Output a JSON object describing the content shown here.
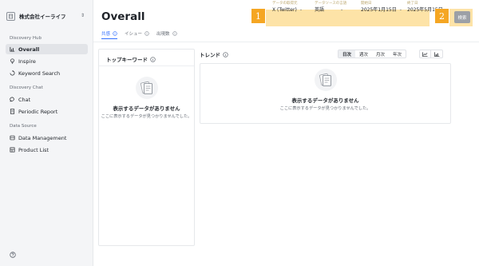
{
  "sidebar": {
    "org_name": "株式会社イーライフ",
    "sections": {
      "hub": "Discovery Hub",
      "chat": "Discovery Chat",
      "source": "Data Source"
    },
    "items": [
      {
        "label": "Overall",
        "icon": "chart-icon",
        "active": true
      },
      {
        "label": "Inspire",
        "icon": "lightbulb-icon"
      },
      {
        "label": "Keyword Search",
        "icon": "search-icon"
      },
      {
        "label": "Chat",
        "icon": "chat-icon"
      },
      {
        "label": "Periodic Report",
        "icon": "document-icon"
      },
      {
        "label": "Data Management",
        "icon": "database-icon"
      },
      {
        "label": "Product List",
        "icon": "list-icon"
      }
    ]
  },
  "page": {
    "title": "Overall"
  },
  "tabs": [
    {
      "label": "共感",
      "active": true
    },
    {
      "label": "イシュー"
    },
    {
      "label": "出現数"
    }
  ],
  "filters": [
    {
      "label": "データの取得元",
      "value": "X (Twitter)"
    },
    {
      "label": "データソースの言語",
      "value": "英語"
    },
    {
      "label": "開始日",
      "value": "2025年1月15日"
    },
    {
      "label": "終了日",
      "value": "2025年5月15日"
    }
  ],
  "badges": [
    "1",
    "2"
  ],
  "search_button": "検索",
  "keywords_panel": {
    "title": "トップキーワード",
    "empty_title": "表示するデータがありません",
    "empty_sub": "ここに表示するデータが見つかりませんでした。"
  },
  "trend_panel": {
    "title": "トレンド",
    "granularity": [
      "日次",
      "週次",
      "月次",
      "年次"
    ],
    "active_granularity": "日次",
    "empty_title": "表示するデータがありません",
    "empty_sub": "ここに表示するデータが見つかりませんでした。"
  },
  "colors": {
    "accent": "#3370ff",
    "highlight": "#fde3a7",
    "badge": "#f5a623"
  }
}
